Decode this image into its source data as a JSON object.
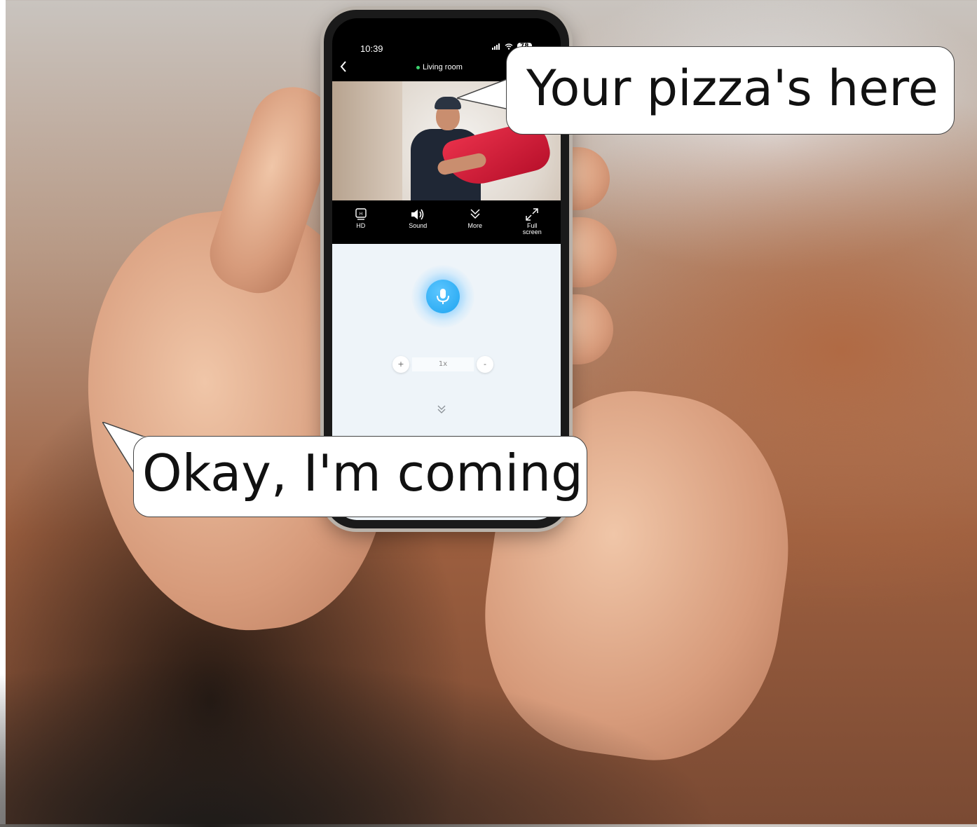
{
  "status_bar": {
    "time": "10:39",
    "battery": "78"
  },
  "header": {
    "room": "Living room"
  },
  "controls": [
    {
      "label": "HD"
    },
    {
      "label": "Sound"
    },
    {
      "label": "More"
    },
    {
      "label": "Full screen"
    }
  ],
  "zoom": {
    "plus": "+",
    "level": "1x",
    "minus": "-"
  },
  "bubbles": {
    "top": "Your pizza's here",
    "bottom": "Okay, I'm coming"
  },
  "colors": {
    "accent": "#1ea4f0",
    "live_dot": "#3cd26e",
    "bag": "#d41c38"
  },
  "icons": [
    "back-chevron-icon",
    "hd-icon",
    "speaker-icon",
    "chevron-down-icon",
    "fullscreen-icon",
    "microphone-icon"
  ]
}
